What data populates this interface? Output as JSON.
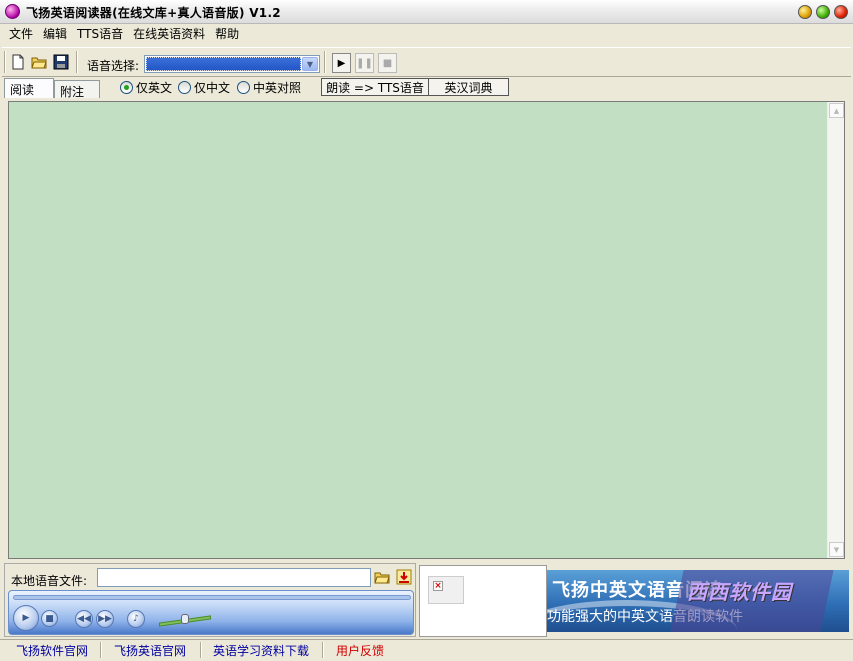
{
  "window": {
    "title": "飞扬英语阅读器(在线文库+真人语音版) V1.2"
  },
  "menu": [
    "文件",
    "编辑",
    "TTS语音",
    "在线英语资料",
    "帮助"
  ],
  "toolbar": {
    "voice_label": "语音选择:",
    "voice_selected": ""
  },
  "tabs": [
    "阅读",
    "附注"
  ],
  "radios": [
    {
      "label": "仅英文",
      "checked": true
    },
    {
      "label": "仅中文",
      "checked": false
    },
    {
      "label": "中英对照",
      "checked": false
    }
  ],
  "fn_buttons": {
    "read_tts": "朗读 => TTS语音",
    "dictionary": "英汉词典"
  },
  "bottom": {
    "local_audio_label": "本地语音文件:",
    "local_audio_value": ""
  },
  "banner": {
    "title": "飞扬中英文语音阅读",
    "subtitle": "功能强大的中英文语音朗读软件",
    "watermark": "西西软件园"
  },
  "status_links": [
    {
      "label": "飞扬软件官网",
      "color": "#0000a0"
    },
    {
      "label": "飞扬英语官网",
      "color": "#0000a0"
    },
    {
      "label": "英语学习资料下载",
      "color": "#0000a0"
    },
    {
      "label": "用户反馈",
      "color": "#d00000"
    }
  ],
  "colors": {
    "reading_bg": "#c2dfc4",
    "selection": "#2456c7"
  }
}
